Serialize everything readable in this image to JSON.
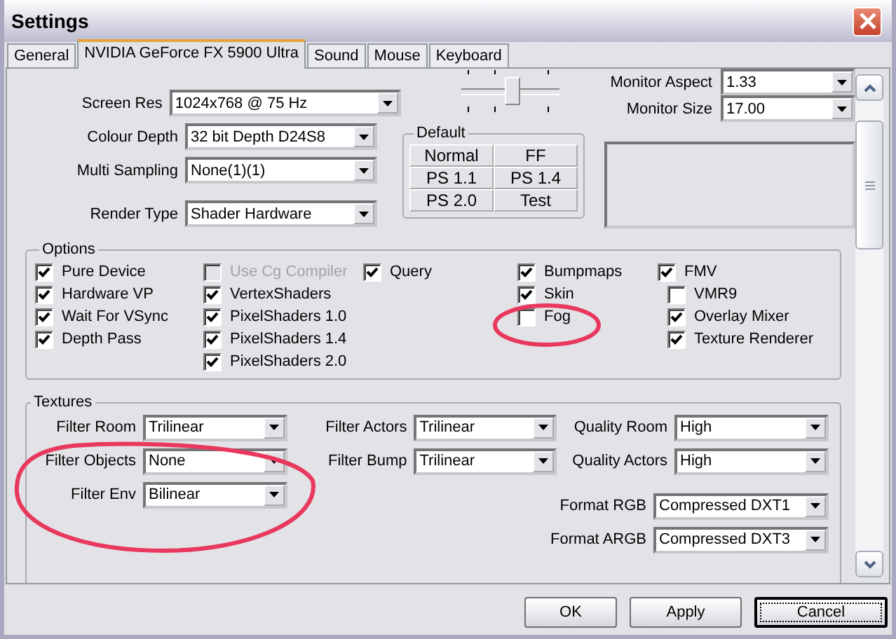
{
  "window": {
    "title": "Settings"
  },
  "tabs": [
    {
      "label": "General",
      "selected": false
    },
    {
      "label": "NVIDIA GeForce FX 5900 Ultra",
      "selected": true
    },
    {
      "label": "Sound",
      "selected": false
    },
    {
      "label": "Mouse",
      "selected": false
    },
    {
      "label": "Keyboard",
      "selected": false
    }
  ],
  "display": {
    "fields": [
      {
        "label": "Screen Res",
        "value": "1024x768 @ 75 Hz"
      },
      {
        "label": "Colour Depth",
        "value": "32 bit Depth D24S8"
      },
      {
        "label": "Multi Sampling",
        "value": "None(1)(1)"
      },
      {
        "label": "Render Type",
        "value": "Shader Hardware"
      }
    ],
    "slider": {
      "level": 0.5
    },
    "monitor": [
      {
        "label": "Monitor Aspect",
        "value": "1.33"
      },
      {
        "label": "Monitor Size",
        "value": "17.00"
      }
    ]
  },
  "default_group": {
    "title": "Default",
    "buttons": [
      "Normal",
      "FF",
      "PS 1.1",
      "PS 1.4",
      "PS 2.0",
      "Test"
    ]
  },
  "options": {
    "title": "Options",
    "columns": [
      [
        {
          "label": "Pure Device",
          "checked": true,
          "disabled": false
        },
        {
          "label": "Hardware VP",
          "checked": true,
          "disabled": false
        },
        {
          "label": "Wait For VSync",
          "checked": true,
          "disabled": false
        },
        {
          "label": "Depth Pass",
          "checked": true,
          "disabled": false
        }
      ],
      [
        {
          "label": "Use Cg Compiler",
          "checked": false,
          "disabled": true
        },
        {
          "label": "VertexShaders",
          "checked": true,
          "disabled": false
        },
        {
          "label": "PixelShaders 1.0",
          "checked": true,
          "disabled": false
        },
        {
          "label": "PixelShaders 1.4",
          "checked": true,
          "disabled": false
        },
        {
          "label": "PixelShaders 2.0",
          "checked": true,
          "disabled": false
        }
      ],
      [
        {
          "label": "Query",
          "checked": true,
          "disabled": false
        }
      ],
      [
        {
          "label": "Bumpmaps",
          "checked": true,
          "disabled": false
        },
        {
          "label": "Skin",
          "checked": true,
          "disabled": false
        },
        {
          "label": "Fog",
          "checked": false,
          "disabled": false
        }
      ],
      [
        {
          "label": "FMV",
          "checked": true,
          "disabled": false
        },
        {
          "label": "VMR9",
          "checked": false,
          "disabled": false
        },
        {
          "label": "Overlay Mixer",
          "checked": true,
          "disabled": false
        },
        {
          "label": "Texture Renderer",
          "checked": true,
          "disabled": false
        }
      ]
    ]
  },
  "textures": {
    "title": "Textures",
    "columns": [
      [
        {
          "label": "Filter Room",
          "value": "Trilinear"
        },
        {
          "label": "Filter Objects",
          "value": "None"
        },
        {
          "label": "Filter Env",
          "value": "Bilinear"
        }
      ],
      [
        {
          "label": "Filter Actors",
          "value": "Trilinear"
        },
        {
          "label": "Filter Bump",
          "value": "Trilinear"
        }
      ],
      [
        {
          "label": "Quality Room",
          "value": "High"
        },
        {
          "label": "Quality Actors",
          "value": "High"
        },
        {
          "label": "Format RGB",
          "value": "Compressed DXT1"
        },
        {
          "label": "Format ARGB",
          "value": "Compressed DXT3"
        }
      ]
    ]
  },
  "buttons": [
    {
      "label": "OK",
      "focused": false
    },
    {
      "label": "Apply",
      "focused": false
    },
    {
      "label": "Cancel",
      "focused": true
    }
  ]
}
